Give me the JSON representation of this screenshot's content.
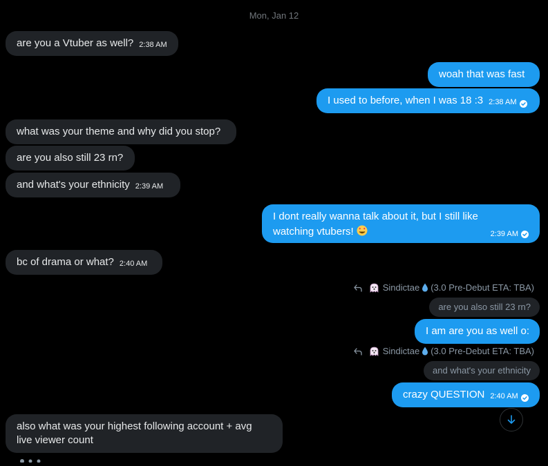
{
  "date_separator": "Mon, Jan 12",
  "messages": [
    {
      "text": "are you a Vtuber as well?",
      "time": "2:38 AM"
    },
    {
      "text": "woah that was fast"
    },
    {
      "text": "I used to before, when I was 18 :3",
      "time": "2:38 AM"
    },
    {
      "text": "what was your theme and why did you stop?"
    },
    {
      "text": "are you also still 23 rn?"
    },
    {
      "text": "and what's your ethnicity",
      "time": "2:39 AM"
    },
    {
      "text": "I dont really wanna talk about it, but I still like watching vtubers!",
      "time": "2:39 AM",
      "emoji": "grinning-face-with-hearts"
    },
    {
      "text": "bc of drama or what?",
      "time": "2:40 AM"
    },
    {
      "text": "I am are you as well o:"
    },
    {
      "text": "crazy QUESTION",
      "time": "2:40 AM"
    },
    {
      "text": "also what was your highest following account + avg live viewer count"
    }
  ],
  "replies": [
    {
      "sender": "Sindictae",
      "sender_suffix": "(3.0 Pre-Debut ETA: TBA)",
      "quoted_text": "are you also still 23 rn?"
    },
    {
      "sender": "Sindictae",
      "sender_suffix": "(3.0 Pre-Debut ETA: TBA)",
      "quoted_text": "and what's your ethnicity"
    }
  ],
  "icons": {
    "reply": "reply-arrow-icon",
    "ghost": "ghost-emoji-icon",
    "droplet": "droplet-emoji-icon",
    "seen": "seen-check-icon",
    "scroll_down": "arrow-down-icon"
  },
  "colors": {
    "background": "#000000",
    "incoming_bubble": "#202327",
    "outgoing_bubble": "#1d9bf0",
    "muted_text": "#71767b"
  }
}
